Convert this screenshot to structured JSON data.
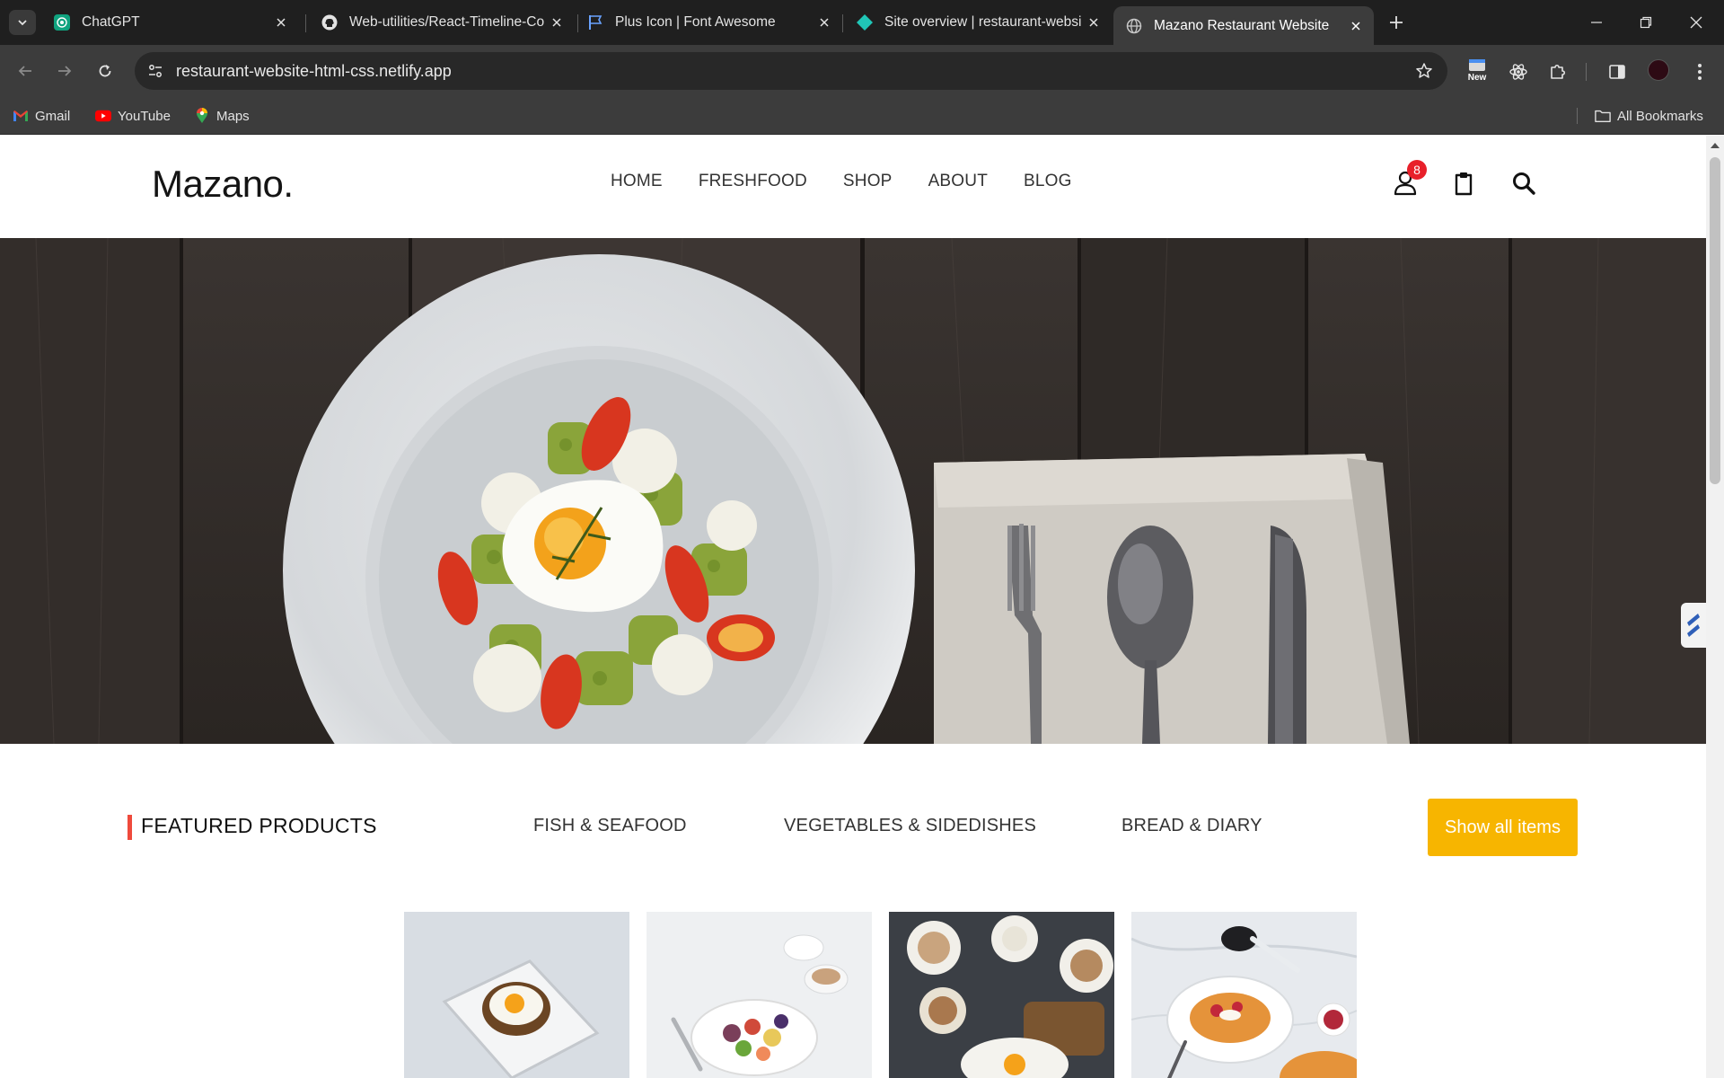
{
  "browser": {
    "tabs": [
      {
        "title": "ChatGPT",
        "icon": "chatgpt-icon"
      },
      {
        "title": "Web-utilities/React-Timeline-Co",
        "icon": "github-icon"
      },
      {
        "title": "Plus Icon | Font Awesome",
        "icon": "font-awesome-flag-icon"
      },
      {
        "title": "Site overview | restaurant-websi",
        "icon": "netlify-icon"
      },
      {
        "title": "Mazano Restaurant Website",
        "icon": "globe-icon",
        "active": true
      }
    ],
    "url": "restaurant-website-html-css.netlify.app",
    "new_badge": "New",
    "bookmarks": [
      {
        "label": "Gmail",
        "icon": "gmail-icon"
      },
      {
        "label": "YouTube",
        "icon": "youtube-icon"
      },
      {
        "label": "Maps",
        "icon": "maps-icon"
      }
    ],
    "all_bookmarks": "All Bookmarks"
  },
  "site": {
    "logo": "Mazano.",
    "nav": [
      "HOME",
      "FRESHFOOD",
      "SHOP",
      "ABOUT",
      "BLOG"
    ],
    "user_badge": "8",
    "accent_color": "#f7b500",
    "featured": {
      "title": "FEATURED PRODUCTS",
      "tabs": [
        "FISH & SEAFOOD",
        "VEGETABLES & SIDEDISHES",
        "BREAD & DIARY"
      ],
      "button": "Show all items"
    },
    "products": [
      {
        "image": "egg-toast-photo"
      },
      {
        "image": "breakfast-bowl-photo"
      },
      {
        "image": "coffee-breakfast-photo"
      },
      {
        "image": "pancakes-photo"
      }
    ]
  }
}
